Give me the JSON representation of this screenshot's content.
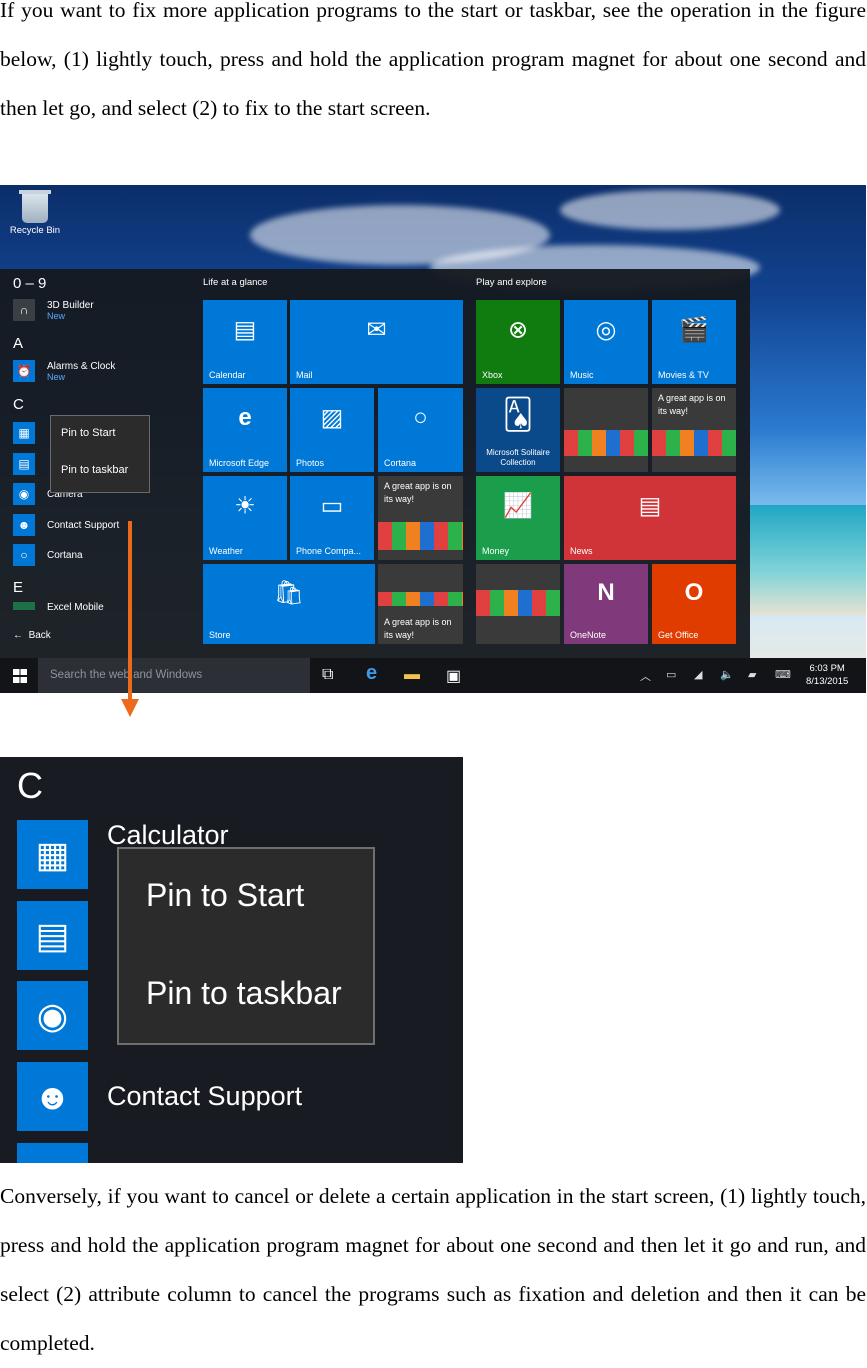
{
  "intro": {
    "paragraph": "If you want to fix more application programs to the start or taskbar, see the operation in the figure below, (1) lightly touch, press and hold the application program magnet for about one second and then let go, and select (2) to fix to the start screen."
  },
  "desktop": {
    "recycle_bin": "Recycle Bin"
  },
  "start_menu": {
    "groups": [
      "0 – 9",
      "A",
      "C",
      "E"
    ],
    "apps": [
      {
        "name": "3D Builder",
        "sub": "New",
        "icon": "3d-builder-icon"
      },
      {
        "name": "Alarms & Clock",
        "sub": "New",
        "icon": "alarm-clock-icon"
      },
      {
        "name": "Calculator",
        "icon": "calculator-icon"
      },
      {
        "name": "Calendar",
        "icon": "calendar-icon"
      },
      {
        "name": "Camera",
        "icon": "camera-icon"
      },
      {
        "name": "Contact Support",
        "icon": "contact-support-icon"
      },
      {
        "name": "Cortana",
        "icon": "cortana-icon"
      },
      {
        "name": "Excel Mobile",
        "icon": "excel-icon"
      }
    ],
    "context_menu": [
      "Pin to Start",
      "Pin to taskbar"
    ],
    "back": "Back",
    "sections": [
      "Life at a glance",
      "Play and explore"
    ],
    "tiles": {
      "calendar": "Calendar",
      "mail": "Mail",
      "edge": "Microsoft Edge",
      "photos": "Photos",
      "cortana": "Cortana",
      "weather": "Weather",
      "phone": "Phone Compa...",
      "promo": "A great app is on its way!",
      "store": "Store",
      "xbox": "Xbox",
      "music": "Music",
      "movies": "Movies & TV",
      "solitaire": "Microsoft Solitaire Collection",
      "money": "Money",
      "news": "News",
      "onenote": "OneNote",
      "office": "Get Office"
    }
  },
  "taskbar": {
    "search_placeholder": "Search the web and Windows",
    "time": "6:03 PM",
    "date": "8/13/2015"
  },
  "zoom": {
    "letter": "C",
    "apps": [
      "Calculator",
      "Contact Support"
    ],
    "context_menu": [
      "Pin to Start",
      "Pin to taskbar"
    ]
  },
  "outro": {
    "paragraph": "Conversely, if you want to cancel or delete a certain application in the start screen, (1) lightly touch, press and hold the application program magnet for about one second and then let it go and run, and select (2) attribute column to cancel the programs such as fixation and deletion and then it can be completed."
  },
  "colors": {
    "accent": "#0078d7",
    "arrow": "#ec6a1c",
    "xbox": "#107c10",
    "money": "#1b9e4b",
    "news": "#d13438",
    "onenote": "#80397b",
    "office": "#e03c00"
  }
}
